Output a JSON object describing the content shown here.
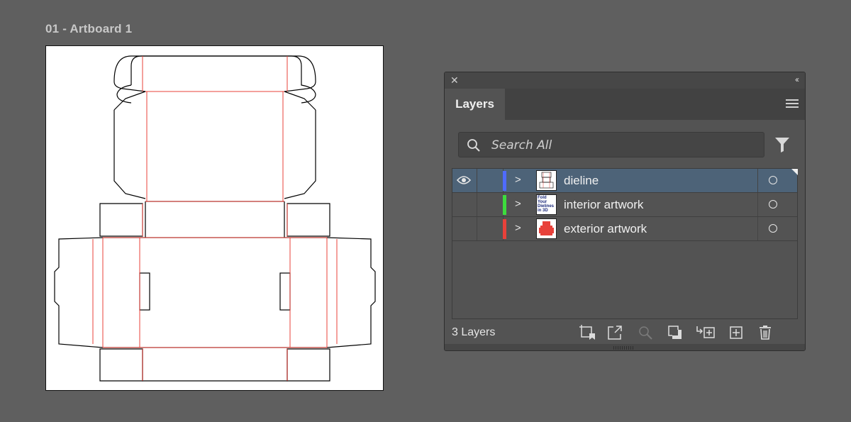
{
  "artboard": {
    "label": "01 - Artboard 1"
  },
  "colors": {
    "app_background": "#5f5f5f",
    "panel_background": "#535353",
    "selection_highlight": "#4d6378",
    "dieline_cut": "#000000",
    "dieline_fold": "#e8413a"
  },
  "panel": {
    "close_icon": "close-icon",
    "collapse_icon": "double-chevron-left-icon",
    "tab_label": "Layers",
    "menu_icon": "hamburger-menu-icon",
    "search": {
      "placeholder": "Search All",
      "value": ""
    },
    "filter_icon": "filter-icon",
    "layers": [
      {
        "name": "dieline",
        "color": "#4f6bff",
        "visible": true,
        "selected": true,
        "thumb": "dieline-thumbnail"
      },
      {
        "name": "interior artwork",
        "color": "#3ddc3d",
        "visible": false,
        "selected": false,
        "thumb": "interior-thumbnail",
        "thumb_text": "Fold Your Dielines in 3D"
      },
      {
        "name": "exterior artwork",
        "color": "#e8413a",
        "visible": false,
        "selected": false,
        "thumb": "exterior-thumbnail"
      }
    ],
    "footer": {
      "count_label": "3 Layers",
      "icons": [
        "collect-for-export-icon",
        "export-icon",
        "locate-object-icon",
        "make-clipping-mask-icon",
        "create-sublayer-icon",
        "new-layer-icon",
        "delete-icon"
      ]
    }
  }
}
